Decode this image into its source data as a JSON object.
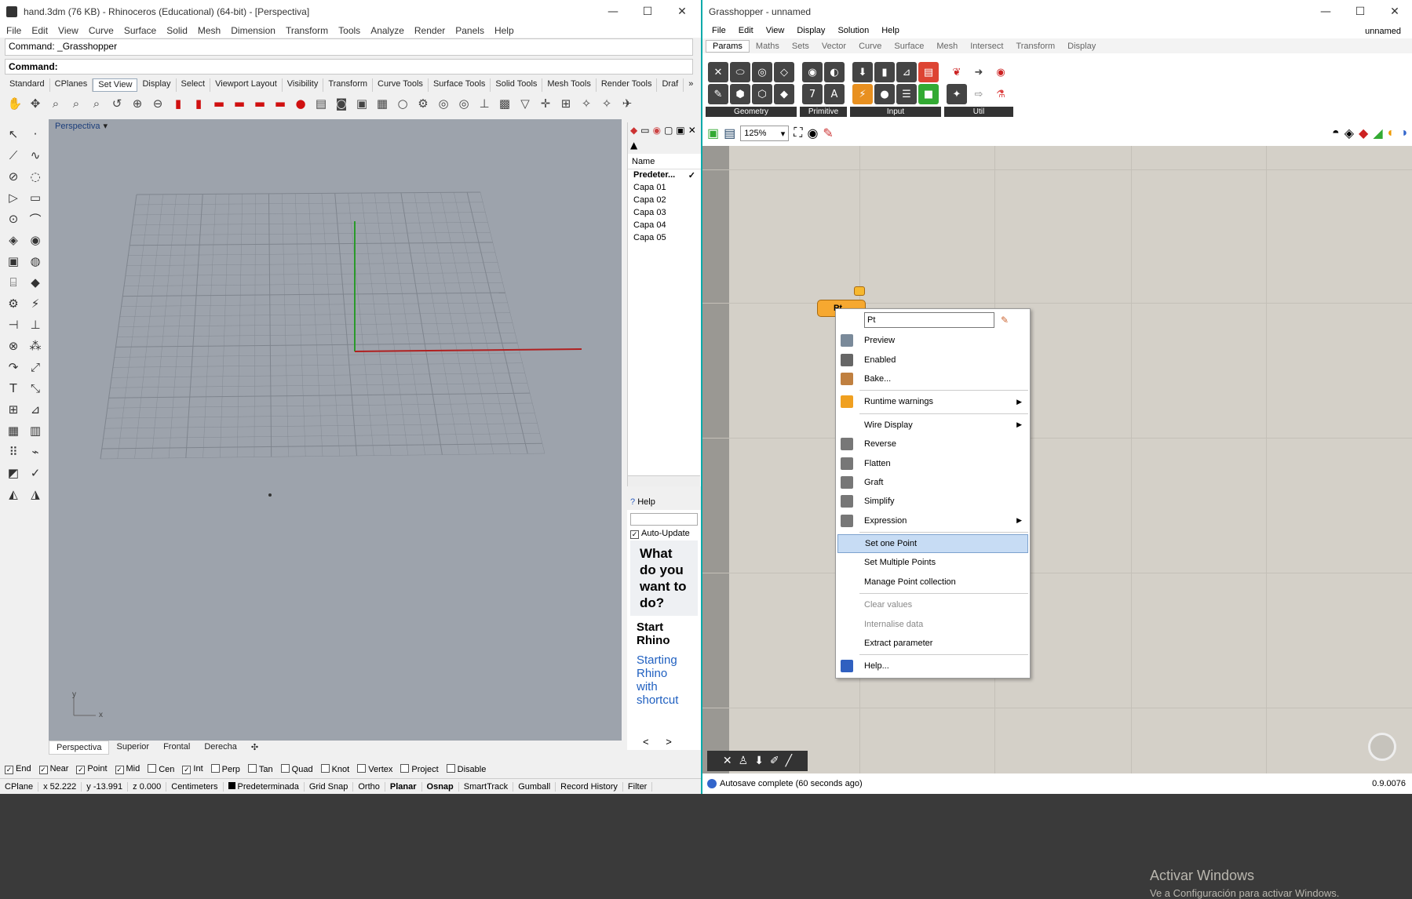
{
  "rhino": {
    "title": "hand.3dm (76 KB) - Rhinoceros (Educational) (64-bit) - [Perspectiva]",
    "window_controls": [
      "—",
      "☐",
      "✕"
    ],
    "menu": [
      "File",
      "Edit",
      "View",
      "Curve",
      "Surface",
      "Solid",
      "Mesh",
      "Dimension",
      "Transform",
      "Tools",
      "Analyze",
      "Render",
      "Panels",
      "Help"
    ],
    "command_history": "Command: _Grasshopper",
    "command_prompt": "Command:",
    "toolbar_tabs": [
      "Standard",
      "CPlanes",
      "Set View",
      "Display",
      "Select",
      "Viewport Layout",
      "Visibility",
      "Transform",
      "Curve Tools",
      "Surface Tools",
      "Solid Tools",
      "Mesh Tools",
      "Render Tools",
      "Draf"
    ],
    "toolbar_tab_more": "»",
    "viewport_label": "Perspectiva",
    "viewport_dropdown": "▾",
    "axis_y": "y",
    "axis_x": "x",
    "layers": {
      "header": "Name",
      "rows": [
        "Predeter...",
        "Capa 01",
        "Capa 02",
        "Capa 03",
        "Capa 04",
        "Capa 05"
      ],
      "current_check": "✓"
    },
    "help": {
      "tab": "Help",
      "auto_update": "Auto-Update",
      "auto_update_check": "✓",
      "big_text": "What do you want to do?",
      "start_title": "Start Rhino",
      "link": "Starting Rhino with shortcut",
      "nav_prev": "<",
      "nav_next": ">"
    },
    "viewport_tabs": [
      "Perspectiva",
      "Superior",
      "Frontal",
      "Derecha"
    ],
    "viewport_tab_add": "✣",
    "osnaps": [
      {
        "label": "End",
        "checked": true
      },
      {
        "label": "Near",
        "checked": true
      },
      {
        "label": "Point",
        "checked": true
      },
      {
        "label": "Mid",
        "checked": true
      },
      {
        "label": "Cen",
        "checked": false
      },
      {
        "label": "Int",
        "checked": true
      },
      {
        "label": "Perp",
        "checked": false
      },
      {
        "label": "Tan",
        "checked": false
      },
      {
        "label": "Quad",
        "checked": false
      },
      {
        "label": "Knot",
        "checked": false
      },
      {
        "label": "Vertex",
        "checked": false
      },
      {
        "label": "Project",
        "checked": false
      },
      {
        "label": "Disable",
        "checked": false
      }
    ],
    "check_glyph": "✓",
    "status": {
      "cplane": "CPlane",
      "x": "x 52.222",
      "y": "y -13.991",
      "z": "z 0.000",
      "units": "Centimeters",
      "layer": "Predeterminada",
      "grid_snap": "Grid Snap",
      "ortho": "Ortho",
      "planar": "Planar",
      "osnap": "Osnap",
      "smarttrack": "SmartTrack",
      "gumball": "Gumball",
      "record_history": "Record History",
      "filter": "Filter"
    }
  },
  "gh": {
    "title": "Grasshopper - unnamed",
    "window_controls": [
      "—",
      "☐",
      "✕"
    ],
    "doc_name": "unnamed",
    "menu": [
      "File",
      "Edit",
      "View",
      "Display",
      "Solution",
      "Help"
    ],
    "tabs": [
      "Params",
      "Maths",
      "Sets",
      "Vector",
      "Curve",
      "Surface",
      "Mesh",
      "Intersect",
      "Transform",
      "Display"
    ],
    "ribbon_groups": [
      "Geometry",
      "Primitive",
      "Input",
      "Util"
    ],
    "zoom": "125%",
    "zoom_arrow": "▾",
    "component_label": "Pt",
    "context_menu": {
      "search_value": "Pt",
      "items": [
        {
          "label": "Preview",
          "icon": "preview-icon",
          "color": "#7a8a9a"
        },
        {
          "label": "Enabled",
          "icon": "enabled-icon",
          "color": "#666"
        },
        {
          "label": "Bake...",
          "icon": "bake-icon",
          "color": "#c08040"
        },
        {
          "sep": true
        },
        {
          "label": "Runtime warnings",
          "icon": "warning-icon",
          "color": "#f0a020",
          "submenu": true
        },
        {
          "sep": true
        },
        {
          "label": "Wire Display",
          "submenu": true
        },
        {
          "label": "Reverse",
          "icon": "reverse-icon",
          "color": "#777"
        },
        {
          "label": "Flatten",
          "icon": "flatten-icon",
          "color": "#777"
        },
        {
          "label": "Graft",
          "icon": "graft-icon",
          "color": "#777"
        },
        {
          "label": "Simplify",
          "icon": "simplify-icon",
          "color": "#777"
        },
        {
          "label": "Expression",
          "icon": "expression-icon",
          "color": "#777",
          "submenu": true
        },
        {
          "sep": true
        },
        {
          "label": "Set one Point",
          "highlight": true
        },
        {
          "label": "Set Multiple Points"
        },
        {
          "label": "Manage Point collection"
        },
        {
          "sep": true
        },
        {
          "label": "Clear values",
          "disabled": true
        },
        {
          "label": "Internalise data",
          "disabled": true
        },
        {
          "label": "Extract parameter"
        },
        {
          "sep": true
        },
        {
          "label": "Help...",
          "icon": "help-icon",
          "color": "#3060c0"
        }
      ]
    },
    "activate": {
      "line1": "Activar Windows",
      "line2": "Ve a Configuración para activar Windows."
    },
    "status": "Autosave complete (60 seconds ago)",
    "version": "0.9.0076"
  }
}
